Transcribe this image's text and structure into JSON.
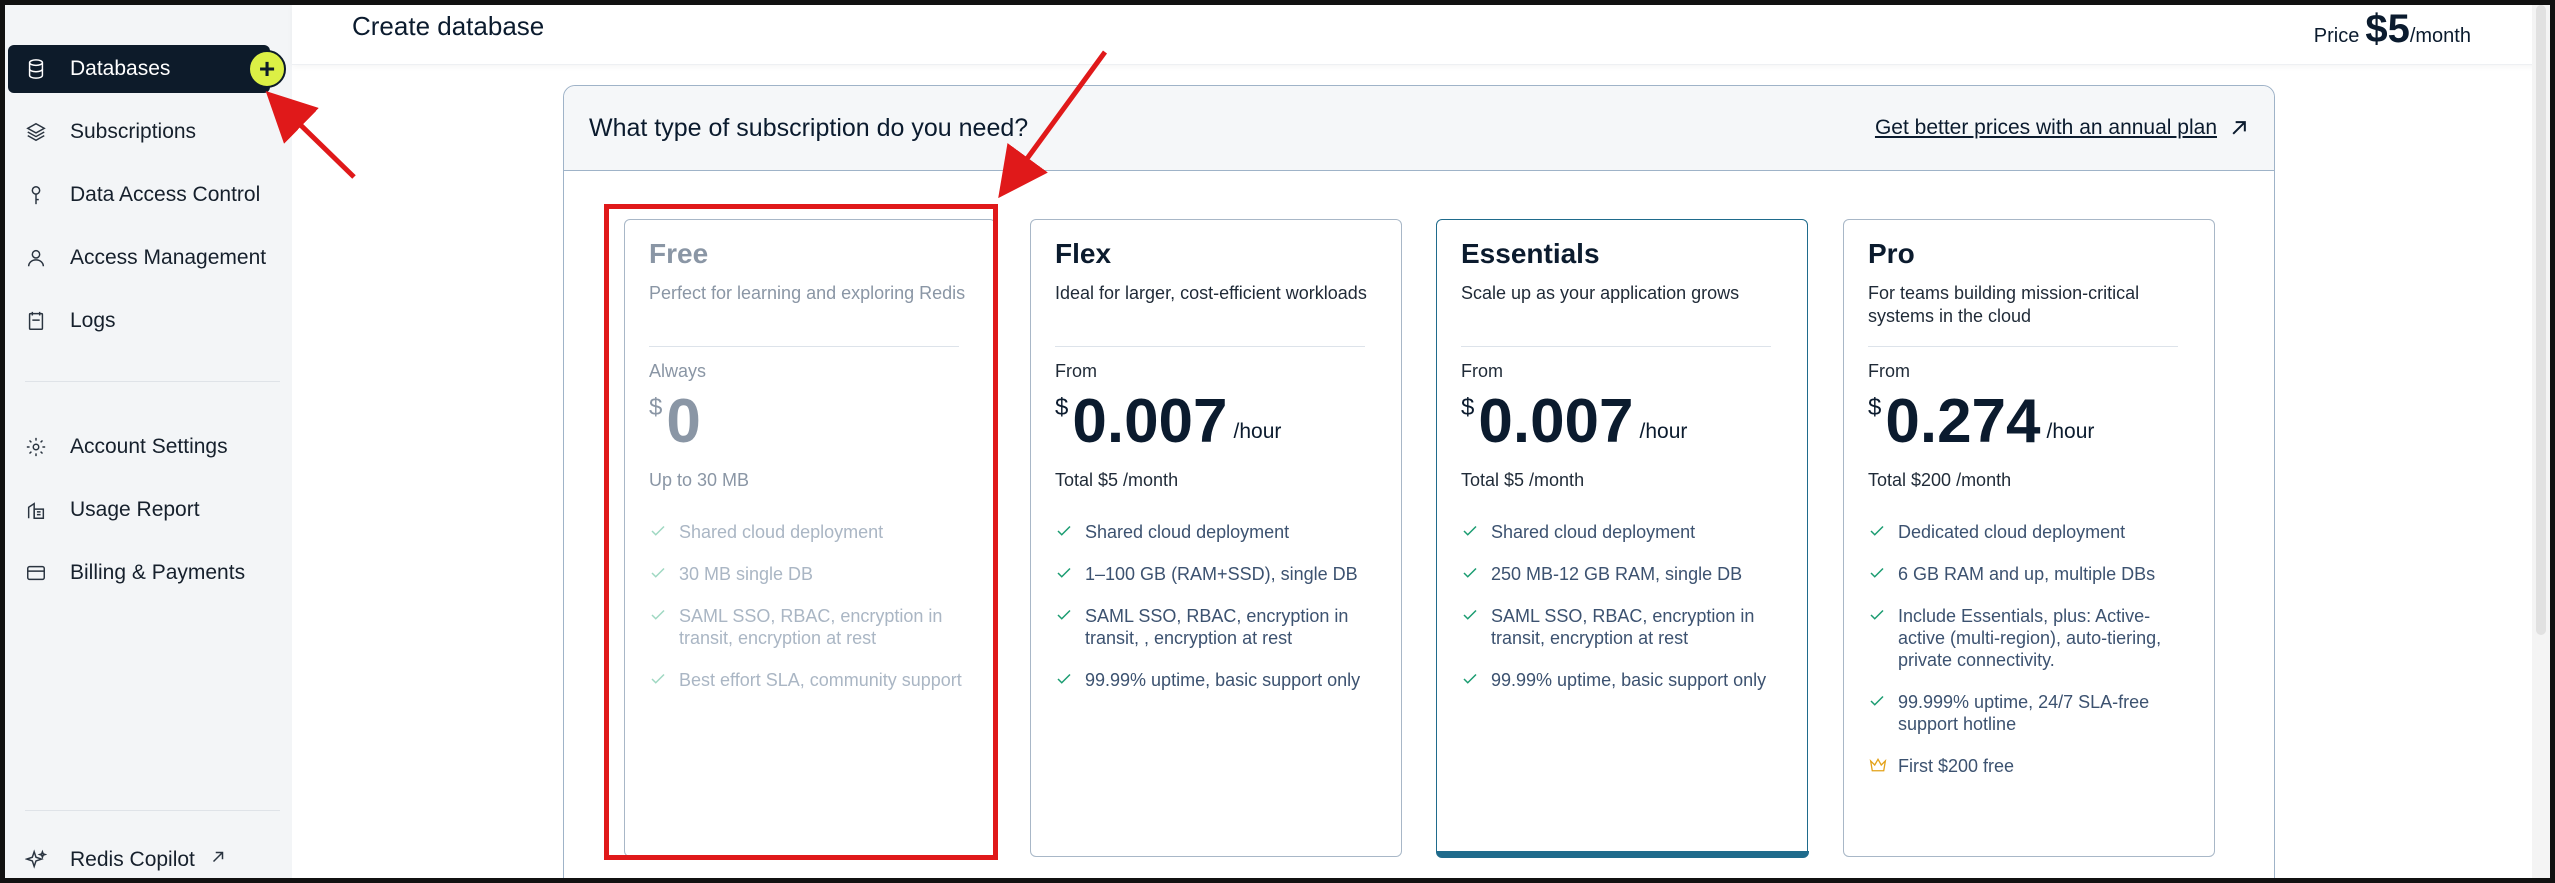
{
  "sidebar": {
    "primary": [
      {
        "label": "Databases",
        "icon": "database-icon",
        "active": true
      },
      {
        "label": "Subscriptions",
        "icon": "layers-icon"
      },
      {
        "label": "Data Access Control",
        "icon": "key-icon"
      },
      {
        "label": "Access Management",
        "icon": "user-icon"
      },
      {
        "label": "Logs",
        "icon": "log-icon"
      }
    ],
    "secondary": [
      {
        "label": "Account Settings",
        "icon": "gear-icon"
      },
      {
        "label": "Usage Report",
        "icon": "report-icon"
      },
      {
        "label": "Billing & Payments",
        "icon": "card-icon"
      }
    ],
    "add_label": "+",
    "copilot": "Redis Copilot"
  },
  "header": {
    "title": "Create database",
    "price_label": "Price",
    "price_amount": "$5",
    "price_period": "/month"
  },
  "panel": {
    "question": "What type of subscription do you need?",
    "annual_link": "Get better prices with an annual plan"
  },
  "plans": [
    {
      "name": "Free",
      "description": "Perfect for learning and exploring Redis",
      "from": "Always",
      "currency": "$",
      "price": "0",
      "unit": "",
      "total": "Up to 30 MB",
      "features": [
        "Shared cloud deployment",
        "30 MB single DB",
        "SAML SSO, RBAC, encryption in transit, encryption at rest",
        "Best effort SLA, community support"
      ]
    },
    {
      "name": "Flex",
      "description": "Ideal for larger, cost-efficient workloads",
      "from": "From",
      "currency": "$",
      "price": "0.007",
      "unit": "/hour",
      "total": "Total $5 /month",
      "features": [
        "Shared cloud deployment",
        "1–100 GB (RAM+SSD), single DB",
        "SAML SSO, RBAC, encryption in transit, , encryption at rest",
        "99.99% uptime, basic support only"
      ]
    },
    {
      "name": "Essentials",
      "description": "Scale up as your application grows",
      "from": "From",
      "currency": "$",
      "price": "0.007",
      "unit": "/hour",
      "total": "Total $5 /month",
      "features": [
        "Shared cloud deployment",
        "250 MB-12 GB RAM, single DB",
        "SAML SSO, RBAC, encryption in transit, encryption at rest",
        "99.99% uptime, basic support only"
      ]
    },
    {
      "name": "Pro",
      "description": "For teams building mission-critical systems in the cloud",
      "from": "From",
      "currency": "$",
      "price": "0.274",
      "unit": "/hour",
      "total": "Total $200 /month",
      "features": [
        "Dedicated cloud deployment",
        "6 GB RAM and up, multiple DBs",
        "Include Essentials, plus: Active-active (multi-region), auto-tiering, private connectivity.",
        "99.999% uptime, 24/7 SLA-free support hotline"
      ],
      "bonus": "First $200 free"
    }
  ],
  "colors": {
    "accent": "#1f6b8c",
    "sidebar_active": "#0d1b2a",
    "add_button": "#dcf045",
    "check": "#1a9c71",
    "annotation": "#e0191a"
  }
}
